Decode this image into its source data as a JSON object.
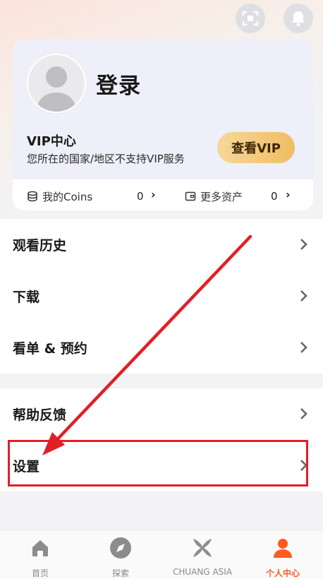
{
  "header": {
    "scan_icon": "scan-icon",
    "bell_icon": "bell-icon"
  },
  "profile": {
    "login_label": "登录",
    "vip_title": "VIP中心",
    "vip_subtitle": "您所在的国家/地区不支持VIP服务",
    "vip_button": "查看VIP",
    "coins_label": "我的Coins",
    "coins_value": "0",
    "assets_label": "更多资产",
    "assets_value": "0"
  },
  "menu_group_1": [
    {
      "label": "观看历史"
    },
    {
      "label": "下载"
    },
    {
      "label": "看单 & 预约"
    }
  ],
  "menu_group_2": [
    {
      "label": "帮助反馈"
    },
    {
      "label": "设置"
    }
  ],
  "tabbar": {
    "items": [
      {
        "label": "首页",
        "icon": "home-icon"
      },
      {
        "label": "探索",
        "icon": "compass-icon"
      },
      {
        "label": "CHUANG ASIA",
        "icon": "chuang-asia-icon"
      },
      {
        "label": "个人中心",
        "icon": "person-icon"
      }
    ],
    "active_color": "#ff5a1f"
  },
  "colors": {
    "highlight": "#e21f25",
    "vip_button": "#f0bd62"
  }
}
